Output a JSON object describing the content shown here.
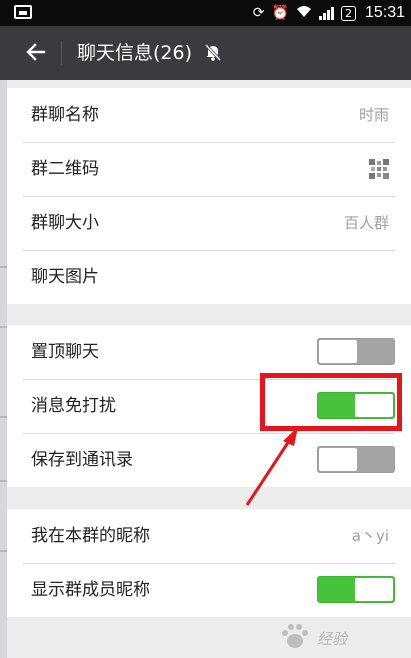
{
  "status_bar": {
    "battery": "2",
    "time": "15:31"
  },
  "header": {
    "title": "聊天信息(26)"
  },
  "group_info": [
    {
      "label": "群聊名称",
      "value": "时雨"
    },
    {
      "label": "群二维码",
      "value": ""
    },
    {
      "label": "群聊大小",
      "value": "百人群"
    },
    {
      "label": "聊天图片",
      "value": ""
    }
  ],
  "chat_settings": [
    {
      "label": "置顶聊天",
      "toggle": "off"
    },
    {
      "label": "消息免打扰",
      "toggle": "on"
    },
    {
      "label": "保存到通讯录",
      "toggle": "off"
    }
  ],
  "nickname_settings": [
    {
      "label": "我在本群的昵称",
      "value": "a丶yi"
    },
    {
      "label": "显示群成员昵称",
      "toggle": "on"
    }
  ],
  "colors": {
    "header_bg": "#3a3a3f",
    "toggle_on": "#46c33a",
    "toggle_off": "#a4a4a4",
    "annotation": "#e8141b"
  },
  "icons": {
    "back": "arrow-left-icon",
    "mute": "bell-muted-icon",
    "qr": "qr-code-icon"
  },
  "watermark": {
    "text": "经验"
  }
}
